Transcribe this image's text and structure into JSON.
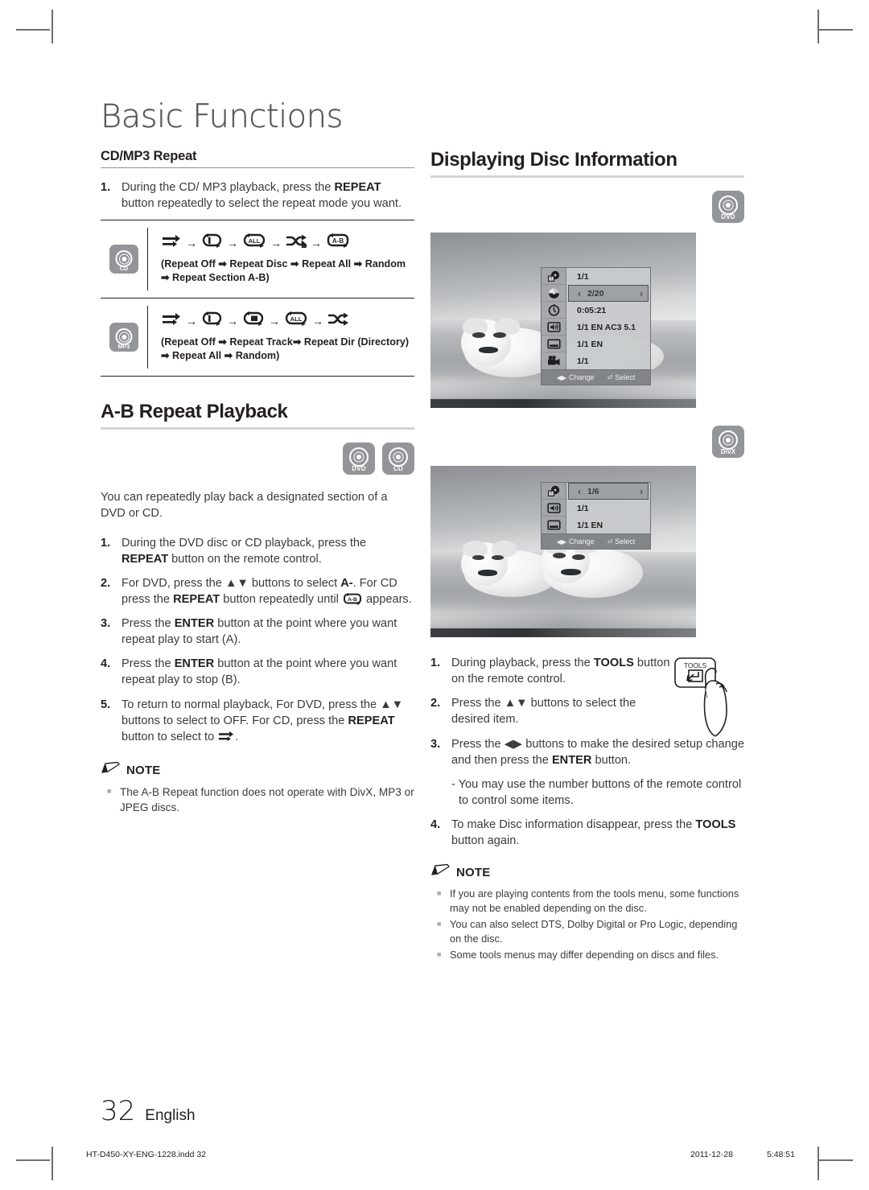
{
  "chapter": {
    "title": "Basic Functions"
  },
  "left": {
    "cdmp3": {
      "heading": "CD/MP3 Repeat",
      "step1": {
        "num": "1.",
        "text_before": "During the CD/ MP3 playback, press the ",
        "bold": "REPEAT",
        "text_after": " button repeatedly to select the repeat mode you want."
      },
      "rows": [
        {
          "disc": "CD",
          "icons": [
            "repeat-off",
            "repeat-disc",
            "repeat-all",
            "random",
            "repeat-ab"
          ],
          "caption": "(Repeat Off ➡ Repeat Disc ➡ Repeat All ➡ Random ➡ Repeat Section A-B)"
        },
        {
          "disc": "MP3",
          "icons": [
            "repeat-off",
            "repeat-track",
            "repeat-dir",
            "repeat-all",
            "random"
          ],
          "caption": "(Repeat Off  ➡ Repeat Track➡ Repeat Dir (Directory) ➡ Repeat All ➡ Random)"
        }
      ]
    },
    "ab": {
      "heading": "A-B Repeat Playback",
      "badges": [
        "DVD",
        "CD"
      ],
      "intro": "You can repeatedly play back a designated section of a DVD or CD.",
      "steps": [
        {
          "num": "1.",
          "parts": [
            {
              "t": "During the DVD disc or CD playback, press the ",
              "b": false
            },
            {
              "t": "REPEAT",
              "b": true
            },
            {
              "t": " button on the remote control.",
              "b": false
            }
          ]
        },
        {
          "num": "2.",
          "parts": [
            {
              "t": "For DVD, press the ▲▼ buttons to select ",
              "b": false
            },
            {
              "t": "A-",
              "b": true
            },
            {
              "t": ". For CD press the ",
              "b": false
            },
            {
              "t": "REPEAT",
              "b": true
            },
            {
              "t": " button repeatedly until ",
              "b": false
            },
            {
              "t": "[A-B]",
              "b": false,
              "icon": "repeat-ab"
            },
            {
              "t": " appears.",
              "b": false
            }
          ]
        },
        {
          "num": "3.",
          "parts": [
            {
              "t": "Press the ",
              "b": false
            },
            {
              "t": "ENTER",
              "b": true
            },
            {
              "t": " button at the point where you want repeat play to start (A).",
              "b": false
            }
          ]
        },
        {
          "num": "4.",
          "parts": [
            {
              "t": "Press the ",
              "b": false
            },
            {
              "t": "ENTER",
              "b": true
            },
            {
              "t": " button at the point where you want repeat play to stop (B).",
              "b": false
            }
          ]
        },
        {
          "num": "5.",
          "parts": [
            {
              "t": "To return to normal playback, For DVD, press the ▲▼ buttons to select to OFF. For CD, press the ",
              "b": false
            },
            {
              "t": "REPEAT",
              "b": true
            },
            {
              "t": " button to select to ",
              "b": false
            },
            {
              "t": "[off]",
              "b": false,
              "icon": "repeat-off"
            },
            {
              "t": ".",
              "b": false
            }
          ]
        }
      ],
      "note": {
        "label": "NOTE",
        "items": [
          "The A-B Repeat function does not operate with DivX, MP3 or JPEG discs."
        ]
      }
    }
  },
  "right": {
    "heading": "Displaying Disc Information",
    "badge_dvd": "DVD",
    "badge_divx": "DivX",
    "osd_dvd": {
      "rows": [
        {
          "icon": "title-icon",
          "value": "1/1",
          "selected": false
        },
        {
          "icon": "chapter-icon",
          "value": "2/20",
          "selected": true
        },
        {
          "icon": "time-icon",
          "value": "0:05:21",
          "selected": false
        },
        {
          "icon": "audio-icon",
          "value": "1/1 EN AC3 5.1",
          "selected": false
        },
        {
          "icon": "subtitle-icon",
          "value": "1/1 EN",
          "selected": false
        },
        {
          "icon": "angle-icon",
          "value": "1/1",
          "selected": false
        }
      ],
      "footer": {
        "change": "Change",
        "select": "Select"
      }
    },
    "osd_divx": {
      "rows": [
        {
          "icon": "title-icon",
          "value": "1/6",
          "selected": true
        },
        {
          "icon": "audio-icon",
          "value": "1/1",
          "selected": false
        },
        {
          "icon": "subtitle-icon",
          "value": "1/1 EN",
          "selected": false
        }
      ],
      "footer": {
        "change": "Change",
        "select": "Select"
      }
    },
    "tools_label": "TOOLS",
    "steps": [
      {
        "num": "1.",
        "parts": [
          {
            "t": "During playback, press the ",
            "b": false
          },
          {
            "t": "TOOLS",
            "b": true
          },
          {
            "t": " button on the remote control.",
            "b": false
          }
        ]
      },
      {
        "num": "2.",
        "parts": [
          {
            "t": "Press the ▲▼ buttons to select the desired item.",
            "b": false
          }
        ]
      },
      {
        "num": "3.",
        "parts": [
          {
            "t": "Press the ◀▶ buttons to make the desired setup change and then press the ",
            "b": false
          },
          {
            "t": "ENTER",
            "b": true
          },
          {
            "t": " button.",
            "b": false
          }
        ]
      }
    ],
    "dash_note": "- You may use the number buttons of the remote control to control some items.",
    "step4": {
      "num": "4.",
      "parts": [
        {
          "t": "To make Disc information disappear, press the ",
          "b": false
        },
        {
          "t": "TOOLS",
          "b": true
        },
        {
          "t": " button again.",
          "b": false
        }
      ]
    },
    "note": {
      "label": "NOTE",
      "items": [
        "If you are playing contents from the tools menu, some functions may not be enabled depending on the disc.",
        "You can also select DTS, Dolby Digital or Pro Logic, depending on the disc.",
        "Some tools menus may differ depending on discs and files."
      ]
    }
  },
  "footer": {
    "page_number": "32",
    "language": "English",
    "filename": "HT-D450-XY-ENG-1228.indd   32",
    "date": "2011-12-28",
    "time": "5:48:51"
  }
}
